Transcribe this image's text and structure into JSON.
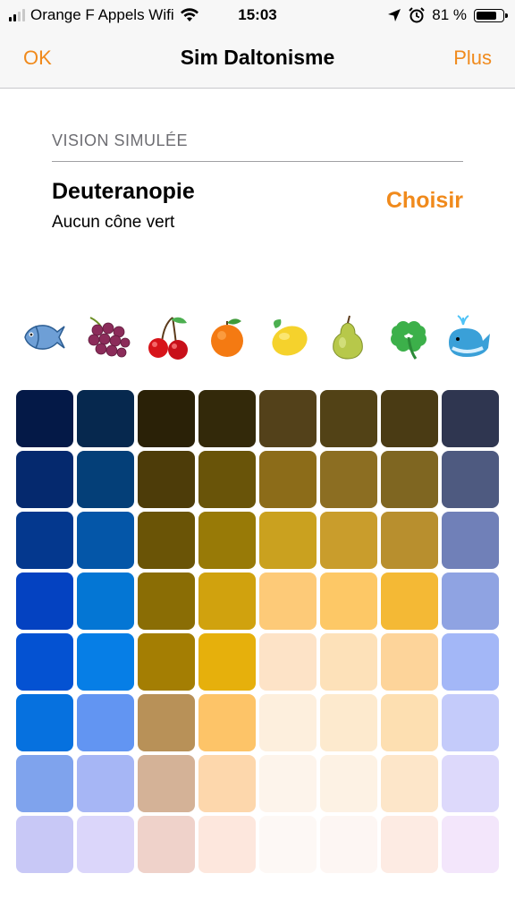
{
  "status_bar": {
    "carrier": "Orange F Appels Wifi",
    "time": "15:03",
    "battery": "81 %",
    "battery_level": 0.81
  },
  "nav": {
    "left_button": "OK",
    "title": "Sim Daltonisme",
    "right_button": "Plus"
  },
  "section": {
    "header": "VISION SIMULÉE",
    "vision_name": "Deuteranopie",
    "vision_desc": "Aucun cône vert",
    "choose_label": "Choisir"
  },
  "icons": [
    "fish-icon",
    "grapes-icon",
    "cherries-icon",
    "orange-icon",
    "lemon-icon",
    "pear-icon",
    "clover-icon",
    "whale-icon"
  ],
  "accent": "#f08a1c",
  "grid_colors": [
    [
      "#041947",
      "#06284e",
      "#2a2107",
      "#33290a",
      "#53411a",
      "#524216",
      "#4a3b14",
      "#2f3650"
    ],
    [
      "#05296e",
      "#043f78",
      "#4d3c09",
      "#695409",
      "#8c6c19",
      "#8c6e22",
      "#7f6621",
      "#4e5a80"
    ],
    [
      "#04388e",
      "#0456a8",
      "#6a5406",
      "#987a07",
      "#caa11f",
      "#c99d2c",
      "#b88f2e",
      "#7080b8"
    ],
    [
      "#0442c1",
      "#0476d4",
      "#8a6d05",
      "#d0a20e",
      "#fdca78",
      "#fdc866",
      "#f4b935",
      "#8fa3e2"
    ],
    [
      "#0452d2",
      "#067ee6",
      "#a47e03",
      "#e6b00c",
      "#fde3c7",
      "#fde1b9",
      "#fdd49a",
      "#a3b7f7"
    ],
    [
      "#0671df",
      "#6295f2",
      "#b89158",
      "#fdc468",
      "#fdefdd",
      "#fdeace",
      "#fddfb1",
      "#c4cbfa"
    ],
    [
      "#7fa3ed",
      "#a6b6f5",
      "#d4b297",
      "#fdd7ac",
      "#fdf4eb",
      "#fdf2e4",
      "#fde6c9",
      "#ddd9fb"
    ],
    [
      "#c8c8f6",
      "#dbd6fa",
      "#efd2ca",
      "#fde7dd",
      "#fdf8f5",
      "#fdf6f3",
      "#fdebe3",
      "#f3e6fb"
    ]
  ]
}
